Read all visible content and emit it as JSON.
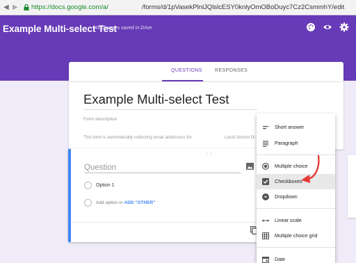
{
  "browser": {
    "secure_host": "https://docs.google.com/a/",
    "path": "/forms/d/1pVasekPlnlJQlslcESY0knlyOmOBoDuyc7Cz2CsmmhY/edit"
  },
  "header": {
    "title": "Example Multi-select Test",
    "saved_status": "All changes saved in Drive"
  },
  "tabs": [
    {
      "label": "QUESTIONS",
      "active": true
    },
    {
      "label": "RESPONSES",
      "active": false
    }
  ],
  "form": {
    "title": "Example Multi-select Test",
    "description_placeholder": "Form description",
    "email_note": "This form is automatically collecting email addresses for",
    "school_note": "Local School Di"
  },
  "question": {
    "title_placeholder": "Question",
    "option_1": "Option 1",
    "add_option": "Add option",
    "or": "or",
    "add_other": "ADD \"OTHER\""
  },
  "menu": {
    "items": [
      {
        "label": "Short answer",
        "icon": "short-answer-icon"
      },
      {
        "label": "Paragraph",
        "icon": "paragraph-icon"
      },
      {
        "label": "Multiple choice",
        "icon": "radio-icon"
      },
      {
        "label": "Checkboxes",
        "icon": "checkbox-icon",
        "selected": true
      },
      {
        "label": "Dropdown",
        "icon": "dropdown-icon"
      },
      {
        "label": "Linear scale",
        "icon": "linear-scale-icon"
      },
      {
        "label": "Multiple choice grid",
        "icon": "grid-icon"
      },
      {
        "label": "Date",
        "icon": "calendar-icon"
      }
    ]
  },
  "colors": {
    "brand": "#673ab7",
    "accent": "#4285f4",
    "annotation_arrow": "#e53935"
  }
}
